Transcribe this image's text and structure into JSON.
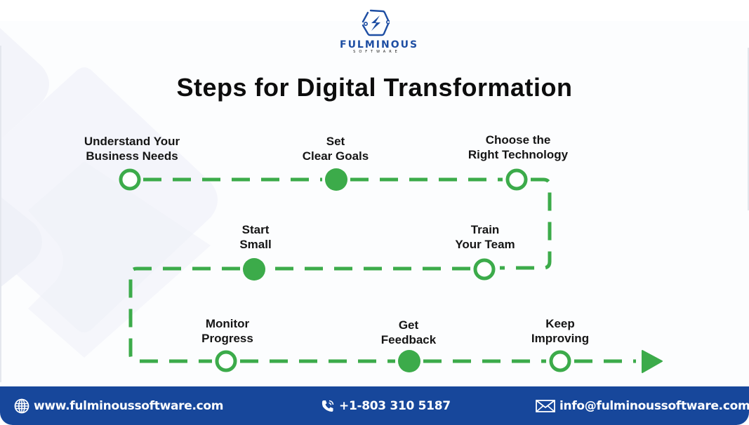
{
  "brand": {
    "name": "FULMINOUS",
    "tagline": "SOFTWARE",
    "logo_icon": "hexagon-lightning-icon",
    "color": "#1e4ea3"
  },
  "title": "Steps for Digital Transformation",
  "colors": {
    "path_green": "#3cab4a",
    "footer_blue": "#17479b",
    "text": "#151515"
  },
  "steps": [
    {
      "order": 1,
      "line1": "Understand Your",
      "line2": "Business Needs",
      "marker": "hollow"
    },
    {
      "order": 2,
      "line1": "Set",
      "line2": "Clear Goals",
      "marker": "filled"
    },
    {
      "order": 3,
      "line1": "Choose the",
      "line2": "Right Technology",
      "marker": "hollow"
    },
    {
      "order": 4,
      "line1": "Train",
      "line2": "Your Team",
      "marker": "hollow"
    },
    {
      "order": 5,
      "line1": "Start",
      "line2": "Small",
      "marker": "filled"
    },
    {
      "order": 6,
      "line1": "Monitor",
      "line2": "Progress",
      "marker": "hollow"
    },
    {
      "order": 7,
      "line1": "Get",
      "line2": "Feedback",
      "marker": "filled"
    },
    {
      "order": 8,
      "line1": "Keep",
      "line2": "Improving",
      "marker": "hollow"
    }
  ],
  "end_marker": "play-arrow-icon",
  "footer": {
    "website": {
      "icon": "globe-icon",
      "text": "www.fulminoussoftware.com"
    },
    "phone": {
      "icon": "phone-icon",
      "text": "+1-803 310 5187"
    },
    "email": {
      "icon": "envelope-icon",
      "text": "info@fulminoussoftware.com"
    }
  }
}
